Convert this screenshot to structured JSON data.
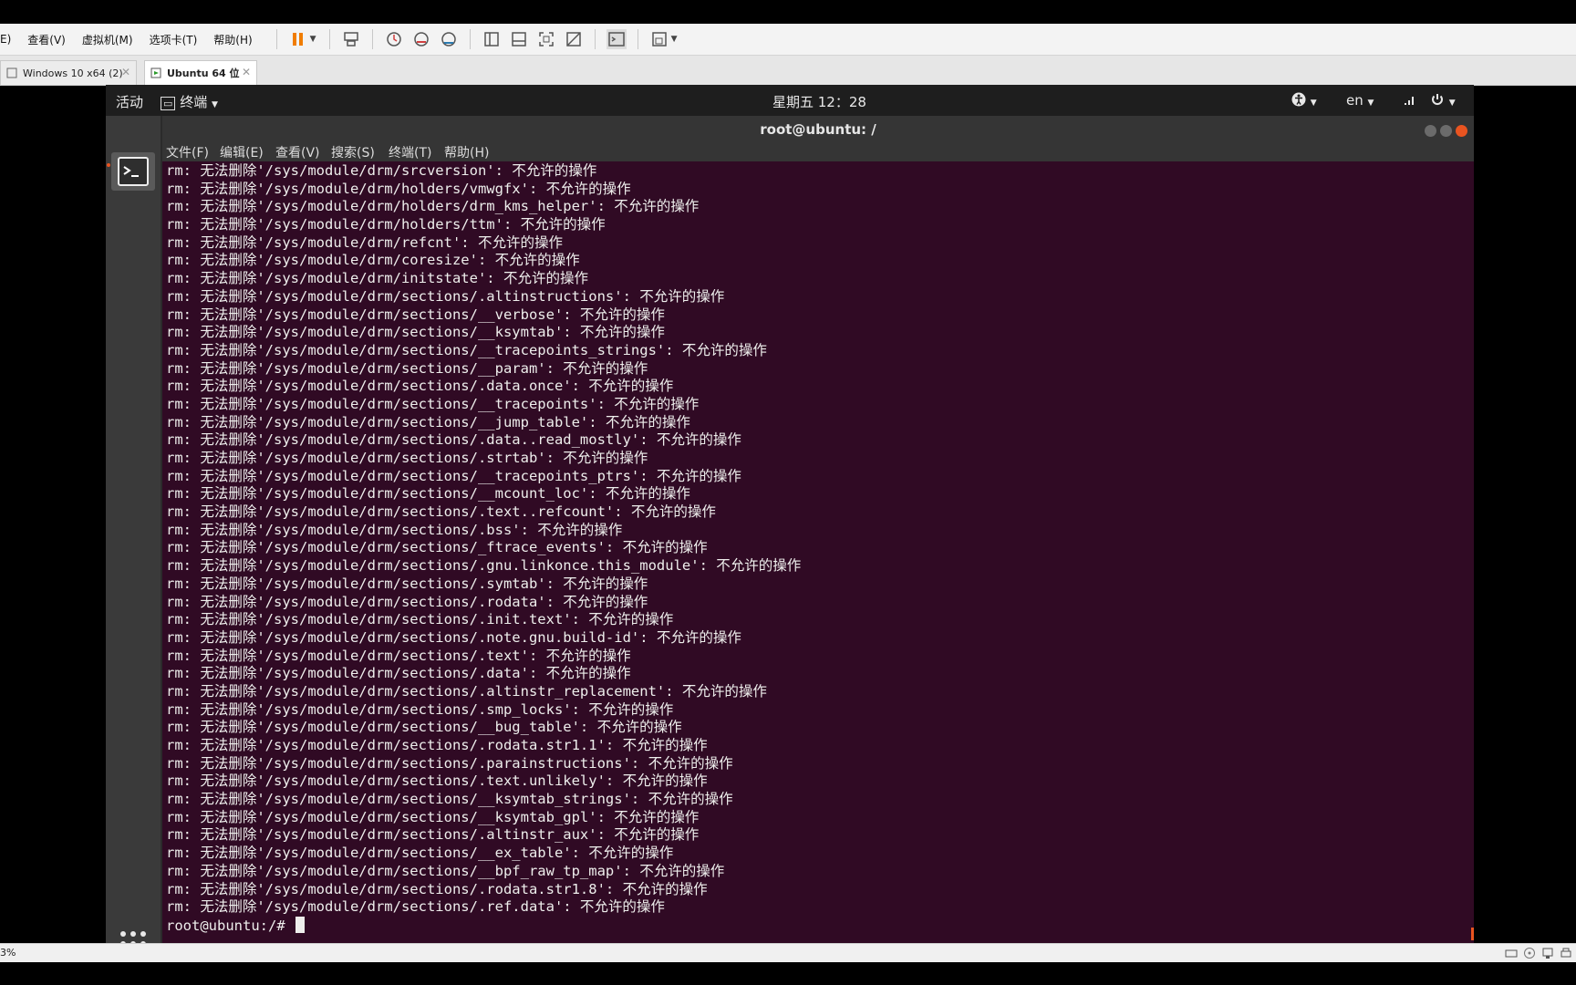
{
  "vmware": {
    "menu": [
      "E)",
      "查看(V)",
      "虚拟机(M)",
      "选项卡(T)",
      "帮助(H)"
    ],
    "tabs": [
      {
        "label": "Windows 10 x64 (2)",
        "active": false
      },
      {
        "label": "Ubuntu 64 位",
        "active": true
      }
    ],
    "status_text": "3%"
  },
  "gnome": {
    "activities": "活动",
    "app_menu": "终端",
    "clock": "星期五 12：28",
    "input_method": "en"
  },
  "terminal": {
    "title": "root@ubuntu: /",
    "menu": [
      "文件(F)",
      "编辑(E)",
      "查看(V)",
      "搜索(S)",
      "终端(T)",
      "帮助(H)"
    ],
    "lines": [
      "rm: 无法删除'/sys/module/drm/srcversion': 不允许的操作",
      "rm: 无法删除'/sys/module/drm/holders/vmwgfx': 不允许的操作",
      "rm: 无法删除'/sys/module/drm/holders/drm_kms_helper': 不允许的操作",
      "rm: 无法删除'/sys/module/drm/holders/ttm': 不允许的操作",
      "rm: 无法删除'/sys/module/drm/refcnt': 不允许的操作",
      "rm: 无法删除'/sys/module/drm/coresize': 不允许的操作",
      "rm: 无法删除'/sys/module/drm/initstate': 不允许的操作",
      "rm: 无法删除'/sys/module/drm/sections/.altinstructions': 不允许的操作",
      "rm: 无法删除'/sys/module/drm/sections/__verbose': 不允许的操作",
      "rm: 无法删除'/sys/module/drm/sections/__ksymtab': 不允许的操作",
      "rm: 无法删除'/sys/module/drm/sections/__tracepoints_strings': 不允许的操作",
      "rm: 无法删除'/sys/module/drm/sections/__param': 不允许的操作",
      "rm: 无法删除'/sys/module/drm/sections/.data.once': 不允许的操作",
      "rm: 无法删除'/sys/module/drm/sections/__tracepoints': 不允许的操作",
      "rm: 无法删除'/sys/module/drm/sections/__jump_table': 不允许的操作",
      "rm: 无法删除'/sys/module/drm/sections/.data..read_mostly': 不允许的操作",
      "rm: 无法删除'/sys/module/drm/sections/.strtab': 不允许的操作",
      "rm: 无法删除'/sys/module/drm/sections/__tracepoints_ptrs': 不允许的操作",
      "rm: 无法删除'/sys/module/drm/sections/__mcount_loc': 不允许的操作",
      "rm: 无法删除'/sys/module/drm/sections/.text..refcount': 不允许的操作",
      "rm: 无法删除'/sys/module/drm/sections/.bss': 不允许的操作",
      "rm: 无法删除'/sys/module/drm/sections/_ftrace_events': 不允许的操作",
      "rm: 无法删除'/sys/module/drm/sections/.gnu.linkonce.this_module': 不允许的操作",
      "rm: 无法删除'/sys/module/drm/sections/.symtab': 不允许的操作",
      "rm: 无法删除'/sys/module/drm/sections/.rodata': 不允许的操作",
      "rm: 无法删除'/sys/module/drm/sections/.init.text': 不允许的操作",
      "rm: 无法删除'/sys/module/drm/sections/.note.gnu.build-id': 不允许的操作",
      "rm: 无法删除'/sys/module/drm/sections/.text': 不允许的操作",
      "rm: 无法删除'/sys/module/drm/sections/.data': 不允许的操作",
      "rm: 无法删除'/sys/module/drm/sections/.altinstr_replacement': 不允许的操作",
      "rm: 无法删除'/sys/module/drm/sections/.smp_locks': 不允许的操作",
      "rm: 无法删除'/sys/module/drm/sections/__bug_table': 不允许的操作",
      "rm: 无法删除'/sys/module/drm/sections/.rodata.str1.1': 不允许的操作",
      "rm: 无法删除'/sys/module/drm/sections/.parainstructions': 不允许的操作",
      "rm: 无法删除'/sys/module/drm/sections/.text.unlikely': 不允许的操作",
      "rm: 无法删除'/sys/module/drm/sections/__ksymtab_strings': 不允许的操作",
      "rm: 无法删除'/sys/module/drm/sections/__ksymtab_gpl': 不允许的操作",
      "rm: 无法删除'/sys/module/drm/sections/.altinstr_aux': 不允许的操作",
      "rm: 无法删除'/sys/module/drm/sections/__ex_table': 不允许的操作",
      "rm: 无法删除'/sys/module/drm/sections/__bpf_raw_tp_map': 不允许的操作",
      "rm: 无法删除'/sys/module/drm/sections/.rodata.str1.8': 不允许的操作",
      "rm: 无法删除'/sys/module/drm/sections/.ref.data': 不允许的操作"
    ],
    "prompt": "root@ubuntu:/# "
  },
  "colors": {
    "terminal_bg": "#300a24",
    "terminal_fg": "#eeeeec",
    "close_button": "#e95420",
    "pause_icon": "#f07d00"
  },
  "icons": [
    "pause-icon",
    "send-ctrl-alt-del-icon",
    "snapshot-icon",
    "revert-snapshot-icon",
    "snapshot-manager-icon",
    "view-icon",
    "fullscreen-icon",
    "unity-icon",
    "console-icon",
    "stretch-icon",
    "accessibility-icon",
    "network-icon",
    "power-icon",
    "terminal-icon",
    "show-apps-icon"
  ]
}
